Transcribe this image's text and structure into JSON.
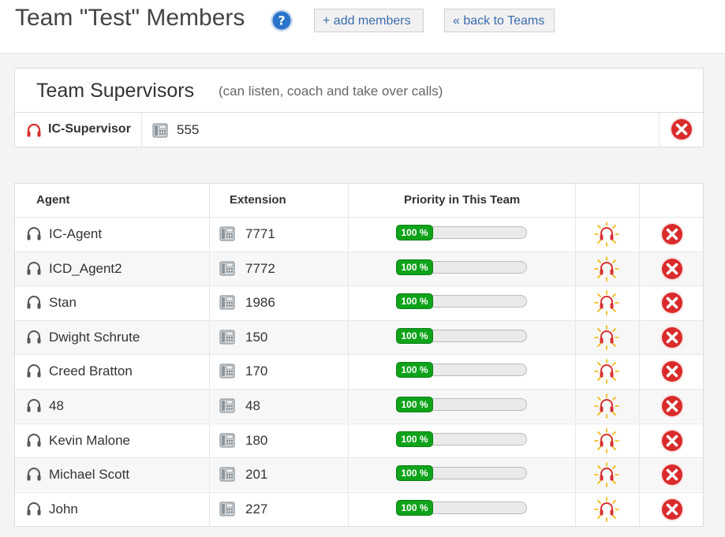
{
  "header": {
    "title": "Team \"Test\" Members",
    "add_members_label": "+ add members",
    "back_label": "« back to Teams"
  },
  "supervisors": {
    "title": "Team Supervisors",
    "subtitle": "(can listen, coach and take over calls)",
    "rows": [
      {
        "name": "IC-Supervisor",
        "extension": "555"
      }
    ]
  },
  "agents": {
    "columns": {
      "agent": "Agent",
      "extension": "Extension",
      "priority": "Priority in This Team"
    },
    "rows": [
      {
        "name": "IC-Agent",
        "extension": "7771",
        "priority": "100 %"
      },
      {
        "name": "ICD_Agent2",
        "extension": "7772",
        "priority": "100 %"
      },
      {
        "name": "Stan",
        "extension": "1986",
        "priority": "100 %"
      },
      {
        "name": "Dwight Schrute",
        "extension": "150",
        "priority": "100 %"
      },
      {
        "name": "Creed Bratton",
        "extension": "170",
        "priority": "100 %"
      },
      {
        "name": "48",
        "extension": "48",
        "priority": "100 %"
      },
      {
        "name": "Kevin Malone",
        "extension": "180",
        "priority": "100 %"
      },
      {
        "name": "Michael Scott",
        "extension": "201",
        "priority": "100 %"
      },
      {
        "name": "John",
        "extension": "227",
        "priority": "100 %"
      }
    ]
  },
  "colors": {
    "link": "#3a6db0",
    "help_blue": "#2a74c9",
    "delete_red": "#d92b2b",
    "priority_green": "#0fa31a",
    "supervisor_headset": "#d83030",
    "promote_glow": "#f0b400"
  },
  "icons": {
    "help": "question-circle-icon",
    "agent": "headset-icon",
    "supervisor": "supervisor-headset-icon",
    "extension": "desk-phone-icon",
    "promote": "promote-to-supervisor-icon",
    "delete": "delete-x-icon"
  }
}
